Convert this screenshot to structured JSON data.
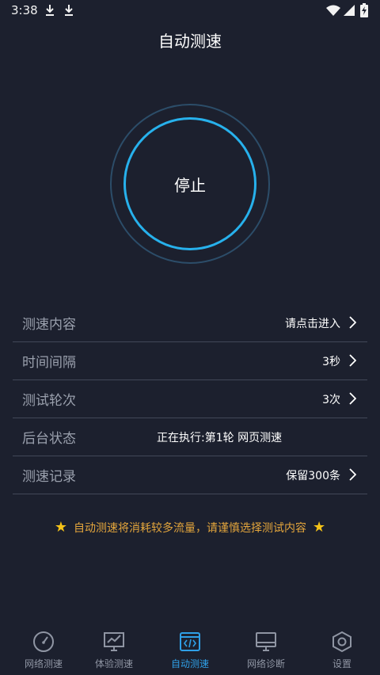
{
  "status": {
    "time": "3:38"
  },
  "header": {
    "title": "自动测速"
  },
  "main": {
    "stop_label": "停止"
  },
  "settings": {
    "rows": [
      {
        "label": "测速内容",
        "value": "请点击进入"
      },
      {
        "label": "时间间隔",
        "value": "3秒"
      },
      {
        "label": "测试轮次",
        "value": "3次"
      },
      {
        "label": "后台状态",
        "value": "正在执行:第1轮 网页测速"
      },
      {
        "label": "测速记录",
        "value": "保留300条"
      }
    ]
  },
  "notice": {
    "text": "自动测速将消耗较多流量，请谨慎选择测试内容"
  },
  "tabs": [
    {
      "label": "网络测速",
      "icon": "speedometer-icon"
    },
    {
      "label": "体验测速",
      "icon": "chart-monitor-icon"
    },
    {
      "label": "自动测速",
      "icon": "code-window-icon"
    },
    {
      "label": "网络诊断",
      "icon": "monitor-icon"
    },
    {
      "label": "设置",
      "icon": "hexagon-gear-icon"
    }
  ],
  "colors": {
    "background": "#1c202e",
    "accent": "#27b1ec",
    "active_tab": "#2f9fe6",
    "notice": "#e3a53c",
    "star": "#f5c318"
  }
}
